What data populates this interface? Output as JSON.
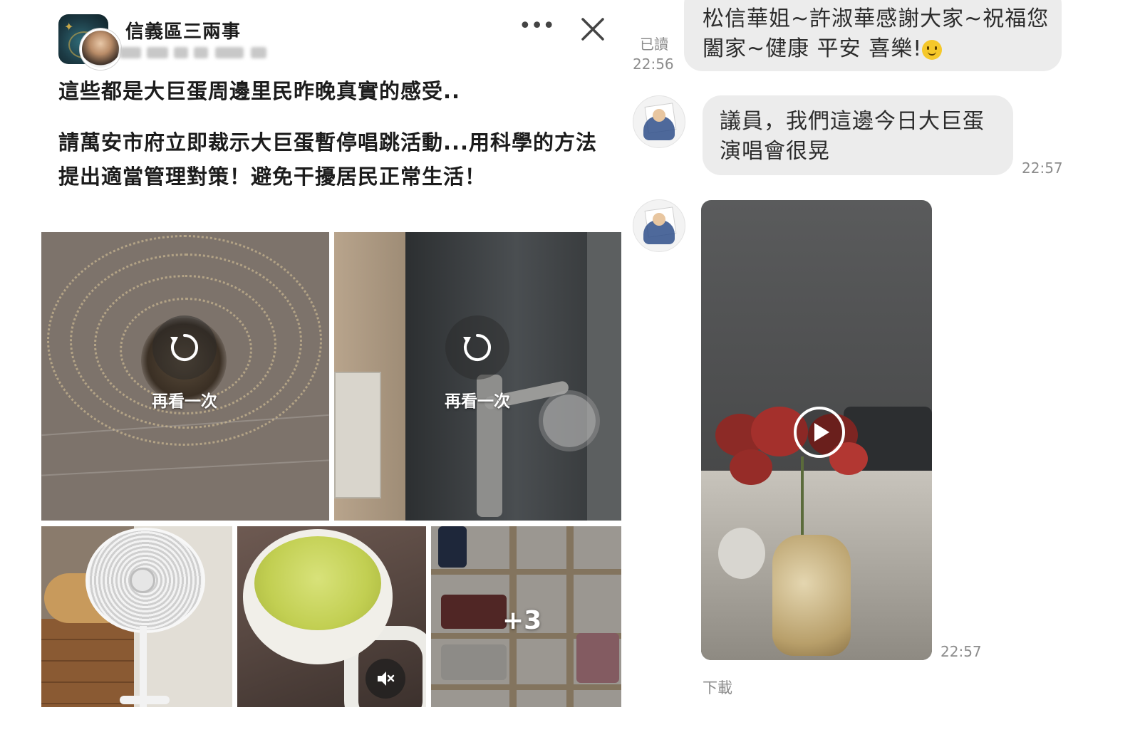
{
  "post": {
    "page_name": "信義區三兩事",
    "text_line1": "這些都是大巨蛋周邊里民昨晚真實的感受..",
    "text_line2": "請萬安市府立即裁示大巨蛋暫停唱跳活動...用科學的方法提出適當管理對策！避免干擾居民正常生活！",
    "replay_label_1": "再看一次",
    "replay_label_2": "再看一次",
    "more_count": "+3",
    "icons": [
      "more-icon",
      "close-icon",
      "replay-icon",
      "mute-icon"
    ]
  },
  "chat": {
    "outgoing": {
      "text": "松信華姐~許淑華感謝大家~祝福您闔家~健康 平安 喜樂!",
      "read_label": "已讀",
      "time": "22:56"
    },
    "incoming_text": {
      "text": "議員，我們這邊今日大巨蛋演唱會很晃",
      "time": "22:57"
    },
    "incoming_video": {
      "time": "22:57",
      "download_label": "下載"
    },
    "colors": {
      "bubble": "#ececec",
      "meta_text": "#8c8c8c"
    }
  }
}
